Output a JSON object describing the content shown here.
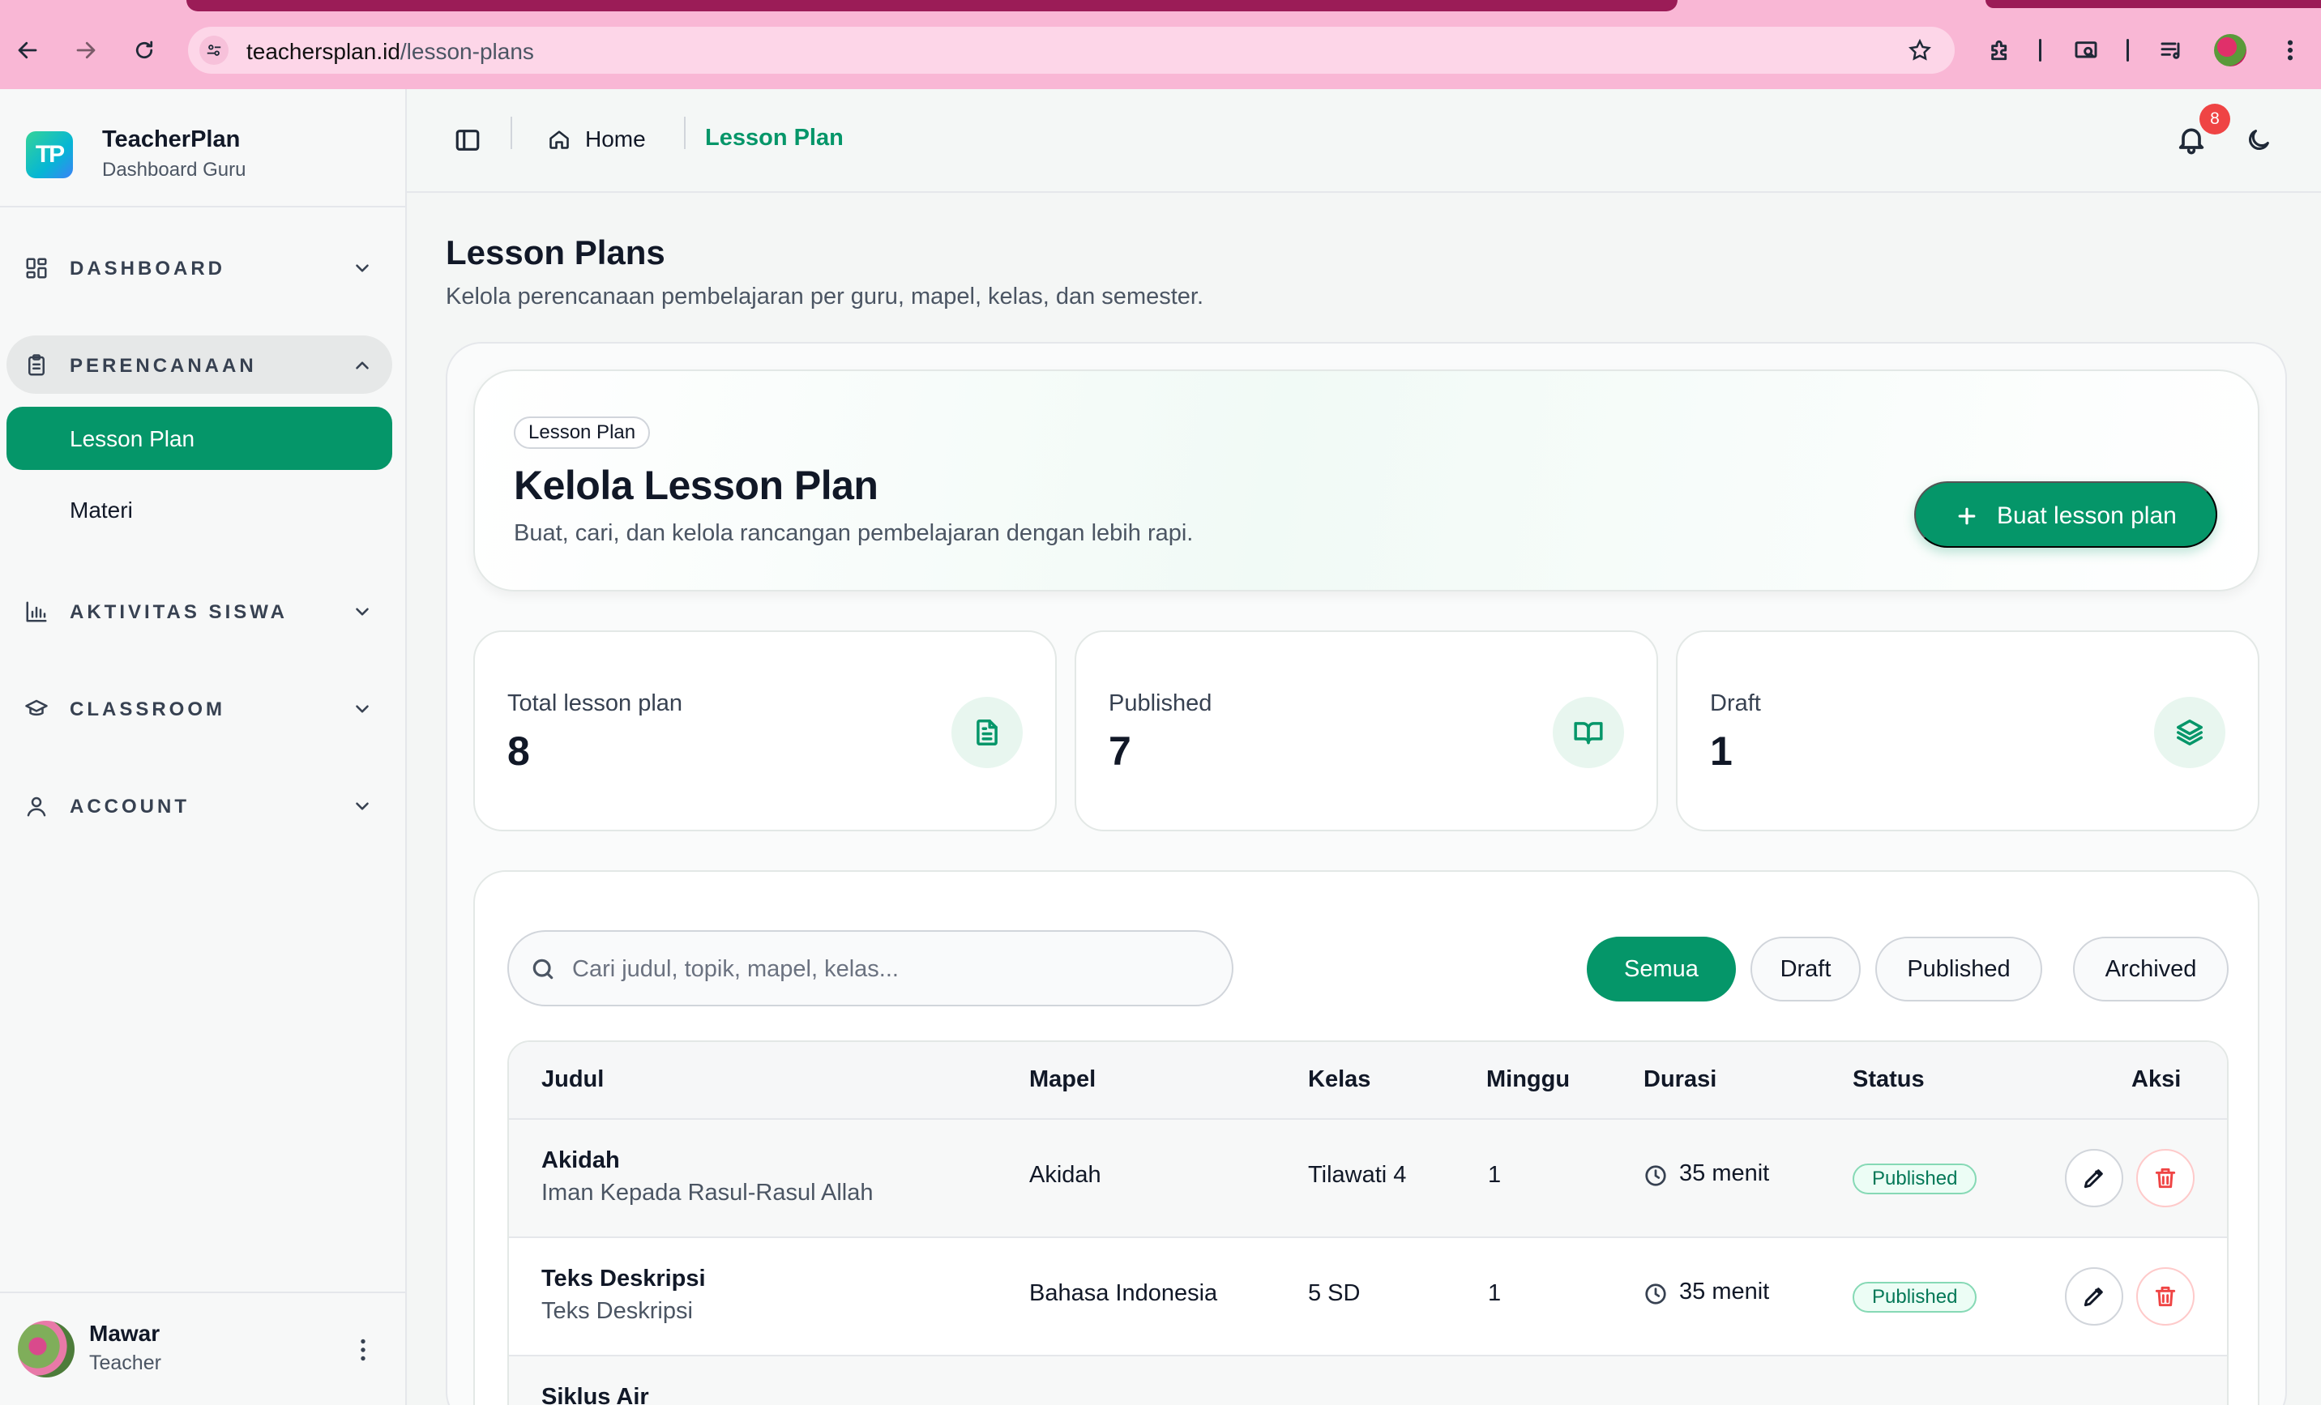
{
  "browser": {
    "url_host": "teachersplan.id",
    "url_path": "/lesson-plans"
  },
  "brand": {
    "logo_text": "TP",
    "name": "TeacherPlan",
    "subtitle": "Dashboard Guru"
  },
  "sidebar": {
    "groups": [
      {
        "label": "DASHBOARD",
        "icon": "layout-grid-icon",
        "expanded": false
      },
      {
        "label": "PERENCANAAN",
        "icon": "clipboard-icon",
        "expanded": true
      },
      {
        "label": "AKTIVITAS SISWA",
        "icon": "bar-chart-icon",
        "expanded": false
      },
      {
        "label": "CLASSROOM",
        "icon": "graduation-cap-icon",
        "expanded": false
      },
      {
        "label": "ACCOUNT",
        "icon": "user-icon",
        "expanded": false
      }
    ],
    "sub_items": [
      {
        "label": "Lesson Plan",
        "active": true
      },
      {
        "label": "Materi",
        "active": false
      }
    ],
    "user": {
      "name": "Mawar",
      "role": "Teacher"
    }
  },
  "appbar": {
    "breadcrumb_home": "Home",
    "breadcrumb_current": "Lesson Plan",
    "notification_count": "8"
  },
  "page": {
    "title": "Lesson Plans",
    "description": "Kelola perencanaan pembelajaran per guru, mapel, kelas, dan semester."
  },
  "hero": {
    "badge": "Lesson Plan",
    "title": "Kelola Lesson Plan",
    "description": "Buat, cari, dan kelola rancangan pembelajaran dengan lebih rapi.",
    "button_label": "Buat lesson plan"
  },
  "stats": [
    {
      "label": "Total lesson plan",
      "value": "8",
      "icon": "file-text-icon"
    },
    {
      "label": "Published",
      "value": "7",
      "icon": "book-open-icon"
    },
    {
      "label": "Draft",
      "value": "1",
      "icon": "layers-icon"
    }
  ],
  "search": {
    "placeholder": "Cari judul, topik, mapel, kelas...",
    "value": ""
  },
  "filters": [
    {
      "label": "Semua",
      "active": true
    },
    {
      "label": "Draft",
      "active": false
    },
    {
      "label": "Published",
      "active": false
    },
    {
      "label": "Archived",
      "active": false
    }
  ],
  "table": {
    "headers": [
      "Judul",
      "Mapel",
      "Kelas",
      "Minggu",
      "Durasi",
      "Status",
      "Aksi"
    ],
    "rows": [
      {
        "title": "Akidah",
        "subtitle": "Iman Kepada Rasul-Rasul Allah",
        "mapel": "Akidah",
        "kelas": "Tilawati 4",
        "minggu": "1",
        "durasi": "35 menit",
        "status": "Published"
      },
      {
        "title": "Teks Deskripsi",
        "subtitle": "Teks Deskripsi",
        "mapel": "Bahasa Indonesia",
        "kelas": "5 SD",
        "minggu": "1",
        "durasi": "35 menit",
        "status": "Published"
      },
      {
        "title": "Siklus Air"
      }
    ]
  },
  "colors": {
    "accent": "#059669",
    "browser_chrome": "#f9b7d5",
    "danger": "#ef4444"
  }
}
